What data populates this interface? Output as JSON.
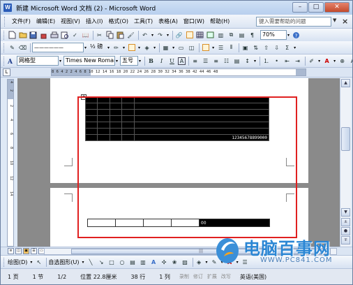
{
  "window": {
    "title": "新建 Microsoft Word 文档 (2) - Microsoft Word",
    "app_icon": "W",
    "minimize": "–",
    "maximize": "□",
    "close": "✕"
  },
  "menu": {
    "items": [
      "文件(F)",
      "编辑(E)",
      "视图(V)",
      "插入(I)",
      "格式(O)",
      "工具(T)",
      "表格(A)",
      "窗口(W)",
      "帮助(H)"
    ],
    "help_placeholder": "键入需要帮助的问题",
    "doc_close": "×"
  },
  "standard_toolbar": {
    "zoom": "70%",
    "zoom_label": "70%"
  },
  "drawing_toolbar_top": {
    "line_width": "½ 磅",
    "line_style": "——————"
  },
  "format_toolbar": {
    "style": "网格型",
    "font": "Times New Roman",
    "size": "五号",
    "bold": "B",
    "italic": "I",
    "underline": "U",
    "char_border": "A"
  },
  "ruler": {
    "corner": "L",
    "numbers": "8  6  4  2     2  4  6  8  10  12  14  16  18  20  22  24  26  28  30  32  34  36  38     42  44  46  48"
  },
  "vruler": {
    "labels": [
      "4",
      "2",
      "2",
      "4",
      "6",
      "8",
      "10",
      "12",
      "14"
    ]
  },
  "document": {
    "table1": {
      "rows": 7,
      "cols": 5,
      "last_cell_text": "12345678899000"
    },
    "table2": {
      "cols": 5,
      "last_cell_text": "00"
    }
  },
  "scrollbar": {
    "up": "▲",
    "down": "▼",
    "prev_page": "±",
    "next_page": "∓"
  },
  "hscroll": {
    "thumb_grip": "|||"
  },
  "draw_toolbar": {
    "draw_label": "绘图(D)",
    "autoshapes_label": "自选图形(U)"
  },
  "status": {
    "page": "1 页",
    "section": "1 节",
    "page_of": "1/2",
    "position": "位置 22.8厘米",
    "line": "38 行",
    "column": "1 列",
    "rec": "录制",
    "trk": "修订",
    "ext": "扩展",
    "ovr": "改写",
    "language": "英语(美国)"
  },
  "colors": {
    "red_box": "#e02020",
    "table_fill": "#000000",
    "title_bar": "#b8cfee",
    "close_button": "#c34a2c"
  }
}
